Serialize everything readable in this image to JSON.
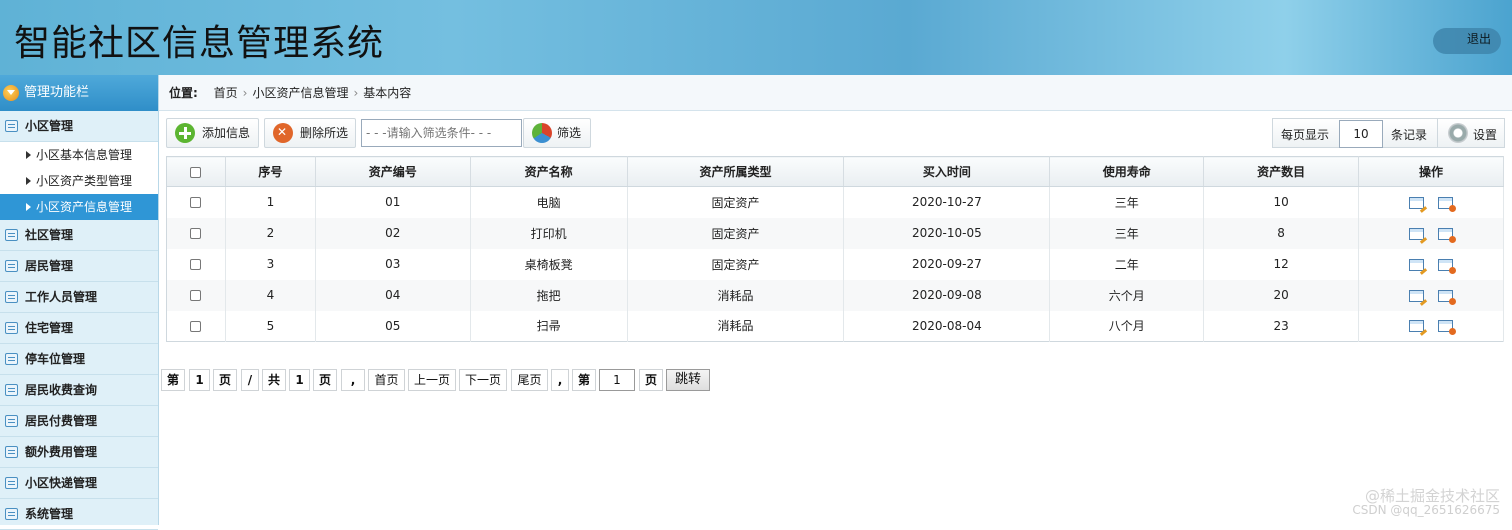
{
  "header": {
    "title": "智能社区信息管理系统",
    "logout_label": "退出"
  },
  "sidebar": {
    "head_label": "管理功能栏",
    "groups": [
      {
        "label": "小区管理",
        "items": [
          "小区基本信息管理",
          "小区资产类型管理",
          "小区资产信息管理"
        ],
        "active_item": "小区资产信息管理"
      },
      {
        "label": "社区管理"
      },
      {
        "label": "居民管理"
      },
      {
        "label": "工作人员管理"
      },
      {
        "label": "住宅管理"
      },
      {
        "label": "停车位管理"
      },
      {
        "label": "居民收费查询"
      },
      {
        "label": "居民付费管理"
      },
      {
        "label": "额外费用管理"
      },
      {
        "label": "小区快递管理"
      },
      {
        "label": "系统管理"
      }
    ]
  },
  "breadcrumb": {
    "prefix": "位置:",
    "items": [
      "首页",
      "小区资产信息管理",
      "基本内容"
    ]
  },
  "toolbar": {
    "add_label": "添加信息",
    "delete_label": "删除所选",
    "filter_placeholder": "- - -请输入筛选条件- - -",
    "filter_label": "筛选",
    "per_page_prefix": "每页显示",
    "per_page_value": "10",
    "per_page_suffix": "条记录",
    "settings_label": "设置"
  },
  "table": {
    "columns": [
      "序号",
      "资产编号",
      "资产名称",
      "资产所属类型",
      "买入时间",
      "使用寿命",
      "资产数目",
      "操作"
    ],
    "rows": [
      {
        "index": "1",
        "code": "01",
        "name": "电脑",
        "type": "固定资产",
        "date": "2020-10-27",
        "life": "三年",
        "count": "10"
      },
      {
        "index": "2",
        "code": "02",
        "name": "打印机",
        "type": "固定资产",
        "date": "2020-10-05",
        "life": "三年",
        "count": "8"
      },
      {
        "index": "3",
        "code": "03",
        "name": "桌椅板凳",
        "type": "固定资产",
        "date": "2020-09-27",
        "life": "二年",
        "count": "12"
      },
      {
        "index": "4",
        "code": "04",
        "name": "拖把",
        "type": "消耗品",
        "date": "2020-09-08",
        "life": "六个月",
        "count": "20"
      },
      {
        "index": "5",
        "code": "05",
        "name": "扫帚",
        "type": "消耗品",
        "date": "2020-08-04",
        "life": "八个月",
        "count": "23"
      }
    ]
  },
  "pager": {
    "di": "第",
    "current": "1",
    "ye": "页",
    "slash": "/",
    "gong": "共",
    "total": "1",
    "ye2": "页",
    "comma": ",",
    "first": "首页",
    "prev": "上一页",
    "next": "下一页",
    "last": "尾页",
    "comma2": ",",
    "di2": "第",
    "goto_value": "1",
    "ye3": "页",
    "jump": "跳转"
  },
  "watermark": {
    "line1": "@稀土掘金技术社区",
    "line2": "CSDN @qq_2651626675"
  }
}
